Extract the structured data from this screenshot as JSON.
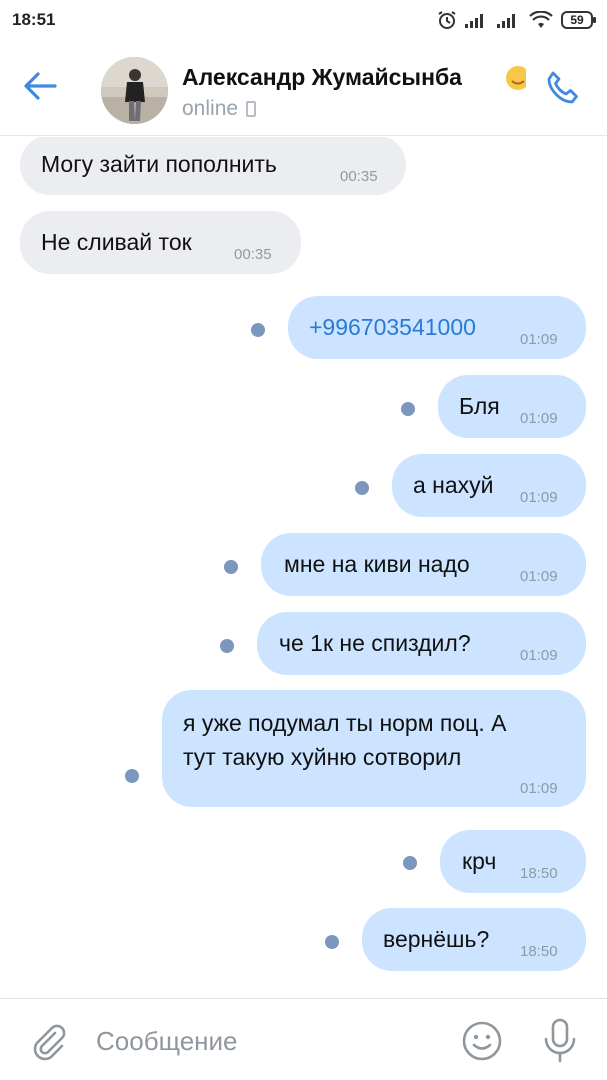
{
  "status_bar": {
    "time": "18:51",
    "battery": "59"
  },
  "header": {
    "contact_name": "Александр Жумайсынба",
    "status": "online"
  },
  "messages": [
    {
      "direction": "in",
      "text": "Могу зайти пополнить",
      "time": "00:35"
    },
    {
      "direction": "in",
      "text": "Не сливай ток",
      "time": "00:35"
    },
    {
      "direction": "out",
      "text": "+996703541000",
      "time": "01:09",
      "link": true
    },
    {
      "direction": "out",
      "text": "Бля",
      "time": "01:09"
    },
    {
      "direction": "out",
      "text": "а нахуй",
      "time": "01:09"
    },
    {
      "direction": "out",
      "text": "мне на киви надо",
      "time": "01:09"
    },
    {
      "direction": "out",
      "text": "че 1к не спиздил?",
      "time": "01:09"
    },
    {
      "direction": "out",
      "text_line1": "я уже подумал ты норм поц. А",
      "text_line2": "тут такую хуйню сотворил",
      "time": "01:09"
    },
    {
      "direction": "out",
      "text": "крч",
      "time": "18:50"
    },
    {
      "direction": "out",
      "text": "вернёшь?",
      "time": "18:50"
    }
  ],
  "composer": {
    "placeholder": "Сообщение"
  },
  "colors": {
    "accent": "#3f8ae0",
    "incoming_bubble": "#ebedf0",
    "outgoing_bubble": "#cce4ff",
    "unread_dot": "#7b97bd"
  }
}
